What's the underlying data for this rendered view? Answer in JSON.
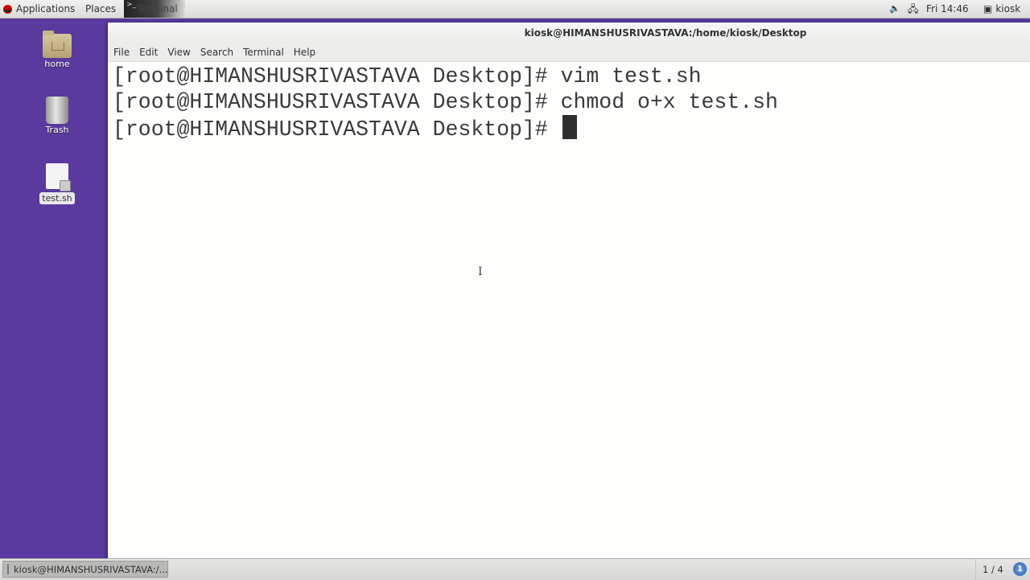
{
  "top_panel": {
    "applications_label": "Applications",
    "places_label": "Places",
    "active_app_label": "Terminal",
    "active_app_glyph": ">_",
    "sound_icon": "🔈",
    "network_icon": "🖧",
    "clock": "Fri 14:46",
    "user_icon": "▣",
    "user": "kiosk"
  },
  "desktop": {
    "icons": [
      {
        "label": "home"
      },
      {
        "label": "Trash"
      },
      {
        "label": "test.sh"
      }
    ]
  },
  "terminal": {
    "title": "kiosk@HIMANSHUSRIVASTAVA:/home/kiosk/Desktop",
    "menu": [
      "File",
      "Edit",
      "View",
      "Search",
      "Terminal",
      "Help"
    ],
    "lines": [
      "[root@HIMANSHUSRIVASTAVA Desktop]# vim test.sh",
      "[root@HIMANSHUSRIVASTAVA Desktop]# chmod o+x test.sh",
      "[root@HIMANSHUSRIVASTAVA Desktop]# "
    ],
    "mouse_cursor": "I"
  },
  "bottom_panel": {
    "task_label": "kiosk@HIMANSHUSRIVASTAVA:/...",
    "workspace": "1 / 4",
    "notification_count": "1"
  }
}
